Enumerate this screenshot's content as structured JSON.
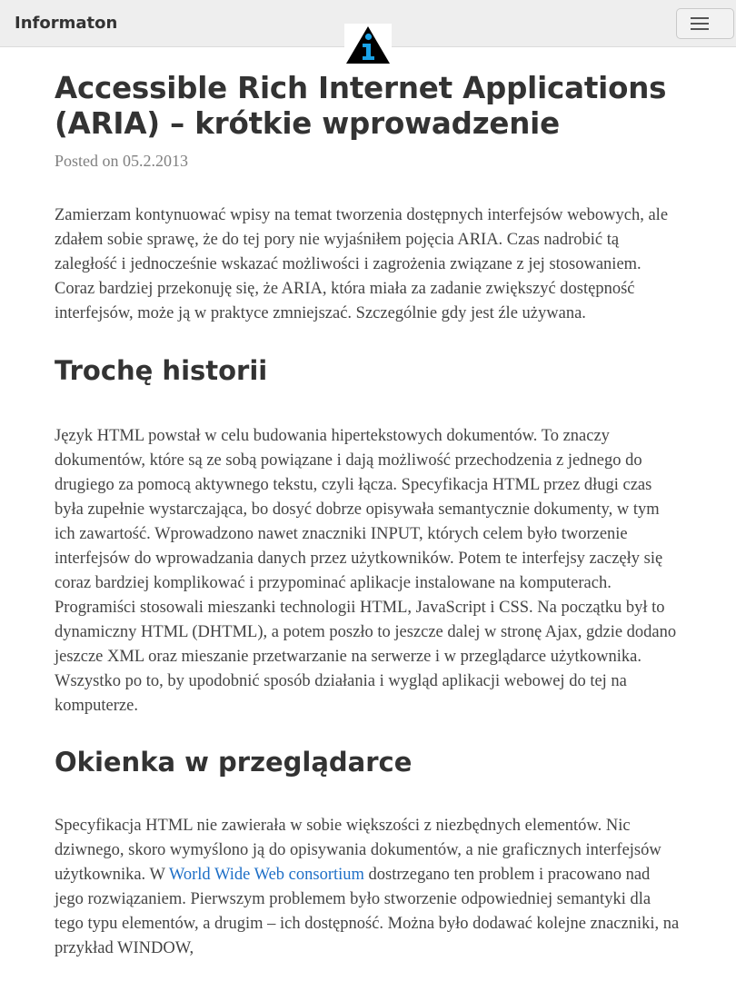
{
  "navbar": {
    "brand": "Informaton",
    "toggle_label": "Toggle navigation"
  },
  "colors": {
    "navbar_bg": "#eeeeee",
    "text": "#444444",
    "meta": "#808080",
    "link": "#1e6fc7",
    "logo_triangle": "#000000",
    "logo_i": "#1aa3e8"
  },
  "post": {
    "title": "Accessible Rich Internet Applications (ARIA) – krótkie wprowadzenie",
    "meta": "Posted on 05.2.2013",
    "intro": "Zamierzam kontynuować wpisy na temat tworzenia dostępnych interfejsów webowych, ale zdałem sobie sprawę, że do tej pory nie wyjaśniłem pojęcia ARIA. Czas nadrobić tą zaległość i jednocześnie wskazać możliwości i zagrożenia związane z jej stosowaniem. Coraz bardziej przekonuję się, że ARIA, która miała za zadanie zwiększyć dostępność interfejsów, może ją w praktyce zmniejszać. Szczególnie gdy jest źle używana.",
    "section1": {
      "heading": "Trochę historii",
      "paragraph": "Język HTML powstał w celu budowania hipertekstowych dokumentów. To znaczy dokumentów, które są ze sobą powiązane i dają możliwość przechodzenia z jednego do drugiego za pomocą aktywnego tekstu, czyli łącza. Specyfikacja HTML przez długi czas była zupełnie wystarczająca, bo dosyć dobrze opisywała semantycznie dokumenty, w tym ich zawartość. Wprowadzono nawet znaczniki INPUT, których celem było tworzenie interfejsów do wprowadzania danych przez użytkowników. Potem te interfejsy zaczęły się coraz bardziej komplikować i przypominać aplikacje instalowane na komputerach. Programiści stosowali mieszanki technologii HTML, JavaScript i CSS. Na początku był to dynamiczny HTML (DHTML), a potem poszło to jeszcze dalej w stronę Ajax, gdzie dodano jeszcze XML oraz mieszanie przetwarzanie na serwerze i w przeglądarce użytkownika. Wszystko po to, by upodobnić sposób działania i wygląd aplikacji webowej do tej na komputerze."
    },
    "section2": {
      "heading": "Okienka w przeglądarce",
      "paragraph_before_link": "Specyfikacja HTML nie zawierała w sobie większości z niezbędnych elementów. Nic dziwnego, skoro wymyślono ją do opisywania dokumentów, a nie graficznych interfejsów użytkownika. W ",
      "link_text": "World Wide Web consortium",
      "paragraph_after_link": " dostrzegano ten problem i pracowano nad jego rozwiązaniem. Pierwszym problemem było stworzenie odpowiedniej semantyki dla tego typu elementów, a drugim – ich dostępność. Można było dodawać kolejne znaczniki, na przykład WINDOW,"
    }
  }
}
